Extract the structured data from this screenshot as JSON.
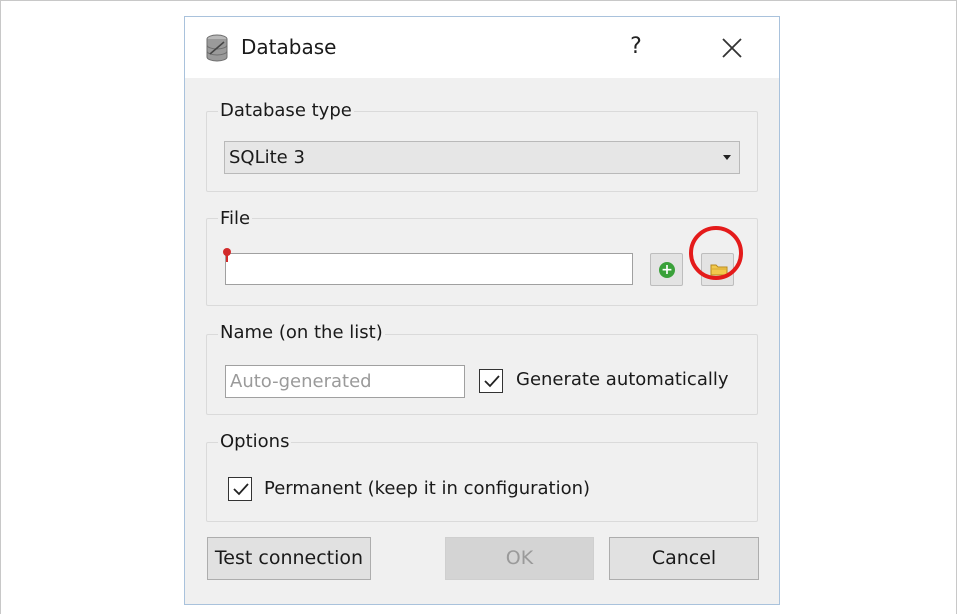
{
  "window": {
    "title": "Database",
    "help_label": "?"
  },
  "database_type": {
    "label": "Database type",
    "selected": "SQLite 3"
  },
  "file": {
    "label": "File",
    "value": ""
  },
  "name": {
    "label": "Name (on the list)",
    "placeholder": "Auto-generated",
    "generate_label": "Generate automatically",
    "generate_checked": true
  },
  "options": {
    "label": "Options",
    "permanent_label": "Permanent (keep it in configuration)",
    "permanent_checked": true
  },
  "buttons": {
    "test_connection": "Test connection",
    "ok": "OK",
    "cancel": "Cancel"
  },
  "colors": {
    "highlight": "#e41b1b",
    "add_icon": "#3aa13a",
    "folder_icon": "#f2c94c"
  }
}
